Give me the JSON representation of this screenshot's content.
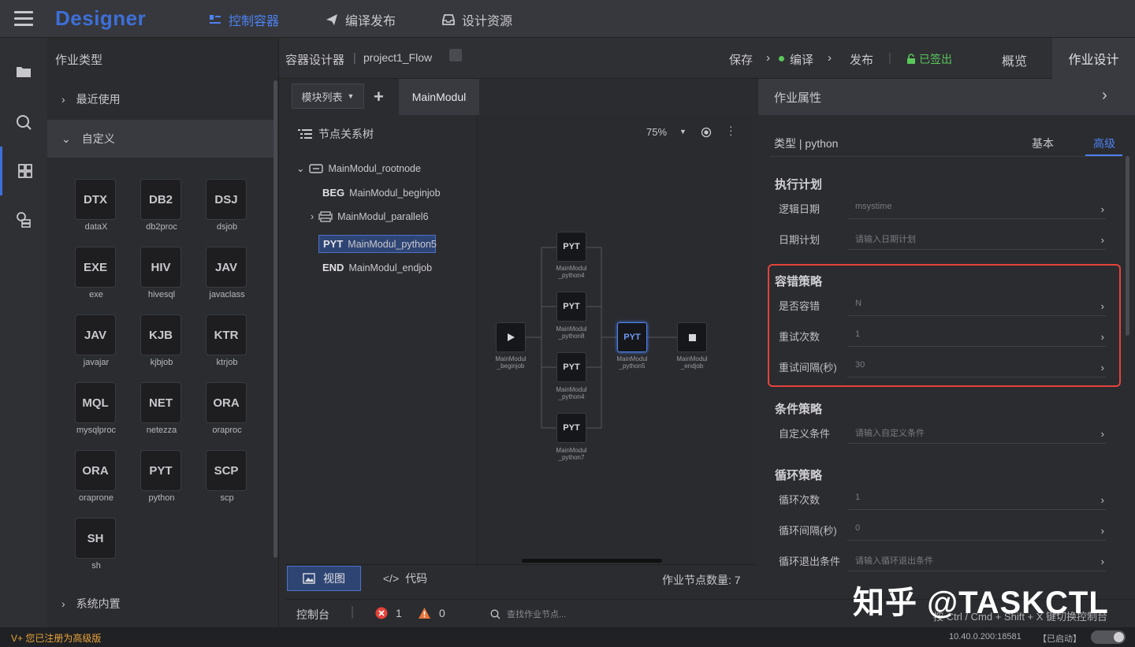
{
  "app": {
    "logo": "Designer"
  },
  "topnav": [
    {
      "label": "控制容器",
      "icon": "container-icon"
    },
    {
      "label": "编译发布",
      "icon": "send-icon"
    },
    {
      "label": "设计资源",
      "icon": "inbox-icon"
    }
  ],
  "palette": {
    "title": "作业类型",
    "group_recent": "最近使用",
    "group_custom": "自定义",
    "group_system": "系统内置",
    "tiles": [
      {
        "code": "DTX",
        "name": "dataX"
      },
      {
        "code": "DB2",
        "name": "db2proc"
      },
      {
        "code": "DSJ",
        "name": "dsjob"
      },
      {
        "code": "EXE",
        "name": "exe"
      },
      {
        "code": "HIV",
        "name": "hivesql"
      },
      {
        "code": "JAV",
        "name": "javaclass"
      },
      {
        "code": "JAV",
        "name": "javajar"
      },
      {
        "code": "KJB",
        "name": "kjbjob"
      },
      {
        "code": "KTR",
        "name": "ktrjob"
      },
      {
        "code": "MQL",
        "name": "mysqlproc"
      },
      {
        "code": "NET",
        "name": "netezza"
      },
      {
        "code": "ORA",
        "name": "oraproc"
      },
      {
        "code": "ORA",
        "name": "oraprone"
      },
      {
        "code": "PYT",
        "name": "python"
      },
      {
        "code": "SCP",
        "name": "scp"
      },
      {
        "code": "SH",
        "name": "sh"
      }
    ]
  },
  "designer": {
    "title": "容器设计器",
    "separator": "|",
    "project": "project1_Flow",
    "save": "保存",
    "compile": "编译",
    "publish": "发布",
    "signed_out": "已签出",
    "overview": "概览",
    "job_design": "作业设计",
    "module_list": "模块列表",
    "module_tab": "MainModul",
    "tree_title": "节点关系树",
    "zoom": "75%",
    "view_btn": "视图",
    "code_btn": "代码",
    "node_count_label": "作业节点数量:",
    "node_count": "7"
  },
  "tree": [
    {
      "tag": "",
      "name": "MainModul_rootnode"
    },
    {
      "tag": "BEG",
      "name": "MainModul_beginjob"
    },
    {
      "tag": "",
      "name": "MainModul_parallel6"
    },
    {
      "tag": "PYT",
      "name": "MainModul_python5"
    },
    {
      "tag": "END",
      "name": "MainModul_endjob"
    }
  ],
  "flow_nodes": [
    {
      "code": "",
      "label": "MainModul\n_beginjob"
    },
    {
      "code": "PYT",
      "label": "MainModul\n_python4"
    },
    {
      "code": "PYT",
      "label": "MainModul\n_python8"
    },
    {
      "code": "PYT",
      "label": "MainModul\n_python4"
    },
    {
      "code": "PYT",
      "label": "MainModul\n_python7"
    },
    {
      "code": "PYT",
      "label": "MainModul\n_python5"
    },
    {
      "code": "",
      "label": "MainModul\n_endjob"
    }
  ],
  "props": {
    "header": "作业属性",
    "type_label": "类型 | python",
    "tab_basic": "基本",
    "tab_advanced": "高级",
    "sections": {
      "exec": "执行计划",
      "fault": "容错策略",
      "cond": "条件策略",
      "loop": "循环策略"
    },
    "fields": {
      "logic_date": {
        "label": "逻辑日期",
        "value": "msystime"
      },
      "date_plan": {
        "label": "日期计划",
        "placeholder": "请输入日期计划"
      },
      "tolerate": {
        "label": "是否容错",
        "value": "N"
      },
      "retry_count": {
        "label": "重试次数",
        "value": "1"
      },
      "retry_interval": {
        "label": "重试间隔(秒)",
        "value": "30"
      },
      "custom_cond": {
        "label": "自定义条件",
        "placeholder": "请输入自定义条件"
      },
      "loop_count": {
        "label": "循环次数",
        "value": "1"
      },
      "loop_interval": {
        "label": "循环间隔(秒)",
        "value": "0"
      },
      "loop_exit": {
        "label": "循环退出条件",
        "placeholder": "请输入循环退出条件"
      }
    }
  },
  "console": {
    "label": "控制台",
    "errors": "1",
    "warnings": "0",
    "search_placeholder": "查找作业节点...",
    "hint": "按 Ctrl / Cmd + Shift + X 键切换控制台"
  },
  "status": {
    "license": "V+ 您已注册为高级版",
    "server": "10.40.0.200:18581",
    "state": "【已启动】"
  },
  "watermark": "知乎 @TASKCTL",
  "colors": {
    "accent": "#3d6fd8",
    "highlight": "#e4433a",
    "success": "#5ac85a"
  }
}
